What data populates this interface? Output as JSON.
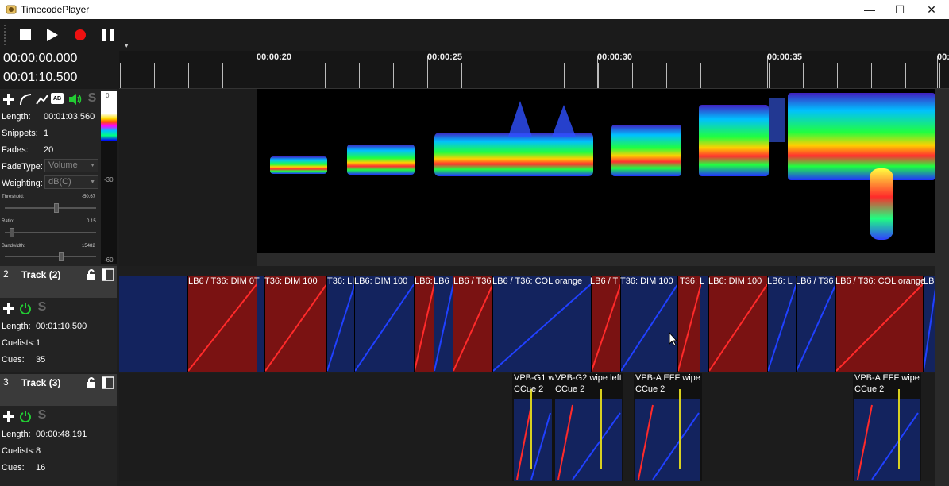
{
  "window": {
    "title": "TimecodePlayer",
    "minimize_glyph": "—",
    "maximize_glyph": "☐",
    "close_glyph": "✕"
  },
  "toolbar": {
    "icons": [
      "stop-icon",
      "play-icon",
      "record-icon",
      "pause-icon"
    ],
    "overflow_glyph": "▾"
  },
  "timecodes": {
    "current": "00:00:00.000",
    "total": "00:01:10.500"
  },
  "ruler": {
    "labels": [
      "00:00:20",
      "00:00:25",
      "00:00:30",
      "00:00:35",
      "00:"
    ]
  },
  "track1": {
    "tool_icons": [
      "add-icon",
      "curve-icon",
      "line-icon",
      "ab-icon",
      "speaker-icon",
      "solo-icon"
    ],
    "solo_label": "S",
    "ab_label": "AB",
    "length_label": "Length:",
    "length_value": "00:01:03.560",
    "snippets_label": "Snippets:",
    "snippets_value": "1",
    "fades_label": "Fades:",
    "fades_value": "20",
    "fadetype_label": "FadeType:",
    "fadetype_value": "Volume",
    "weighting_label": "Weighting:",
    "weighting_value": "dB(C)",
    "threshold_label": "Threshold:",
    "threshold_value": "-50.67",
    "ratio_label": "Ratio:",
    "ratio_value": "0.15",
    "bandwidth_label": "Bandwidth:",
    "bandwidth_value": "15482",
    "meter_labels": [
      "0",
      "-30",
      "-60"
    ]
  },
  "track2": {
    "number": "2",
    "name": "Track (2)",
    "solo_label": "S",
    "length_label": "Length:",
    "length_value": "00:01:10.500",
    "cuelists_label": "Cuelists:",
    "cuelists_value": "1",
    "cues_label": "Cues:",
    "cues_value": "35",
    "clip_labels": [
      "LB6 / T36: DIM 0T",
      "T36: DIM 100",
      "T36: LI",
      "LB6: DIM 100",
      "LB6: L",
      "LB6",
      "LB6 / T36",
      "LB6 / T36: COL orange",
      "LB6 / T",
      "T36: DIM 100",
      "T36: L",
      "LB6: DIM 100",
      "LB6: L",
      "LB6 / T36",
      "LB6 / T36: COL orange",
      "LB"
    ]
  },
  "track3": {
    "number": "3",
    "name": "Track (3)",
    "solo_label": "S",
    "length_label": "Length:",
    "length_value": "00:00:48.191",
    "cuelists_label": "Cuelists:",
    "cuelists_value": "8",
    "cues_label": "Cues:",
    "cues_value": "16",
    "clips": [
      {
        "line1": "VPB-G1 w",
        "line2": "CCue 2"
      },
      {
        "line1": "VPB-G2 wipe left",
        "line2": "CCue 2"
      },
      {
        "line1": "VPB-A EFF wipe",
        "line2": "CCue 2"
      },
      {
        "line1": "VPB-A EFF wipe",
        "line2": "CCue 2"
      }
    ]
  },
  "colors": {
    "clip_red": "#7a1212",
    "clip_blue": "#13235e",
    "red_line": "#ff2a2a",
    "blue_line": "#2040ff",
    "yellow_line": "#d8d020"
  }
}
